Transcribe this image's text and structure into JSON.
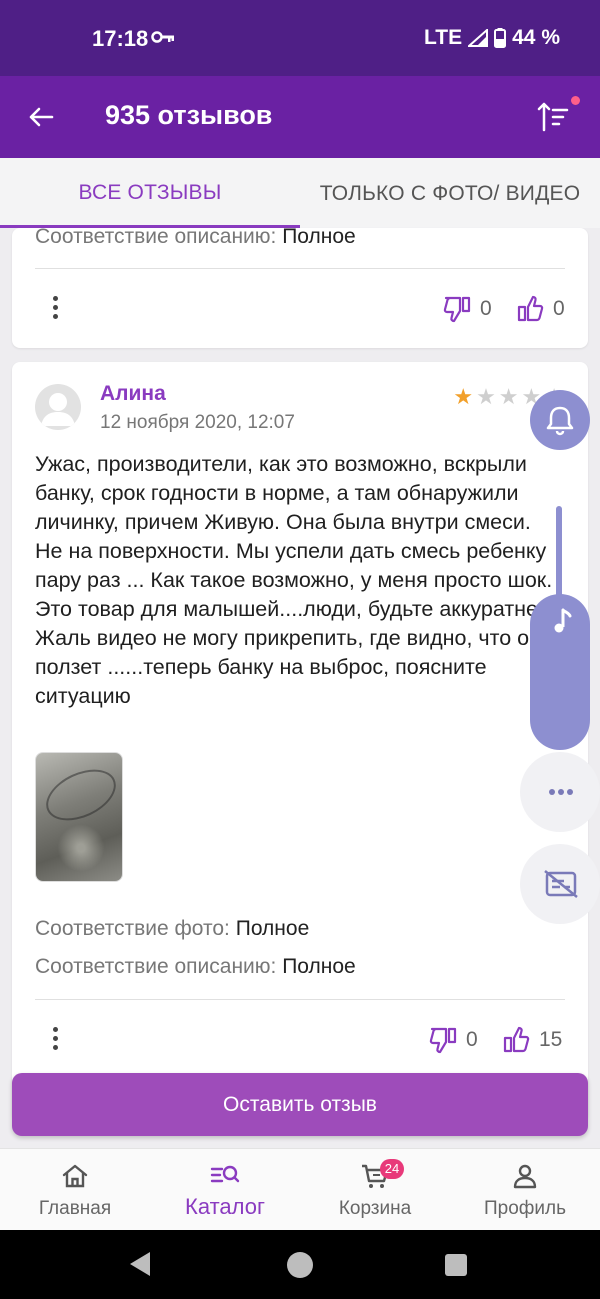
{
  "status_bar": {
    "time": "17:18",
    "network": "LTE",
    "battery": "44 %"
  },
  "app_bar": {
    "title": "935 отзывов"
  },
  "tabs": [
    {
      "label": "Все отзывы"
    },
    {
      "label": "Только с фото/ видео"
    }
  ],
  "review_prev": {
    "match_description_label": "Соответствие описанию:",
    "match_description_value": "Полное",
    "dislikes": "0",
    "likes": "0"
  },
  "review": {
    "author": "Алина",
    "date": "12 ноября 2020, 12:07",
    "rating": 1,
    "rating_max": 5,
    "text": "Ужас, производители, как это возможно, вскрыли банку, срок годности в норме, а там обнаружили личинку, причем Живую. Она была внутри смеси. Не на поверхности. Мы успели дать смесь ребенку пару раз ... Как такое возможно, у меня просто шок. Это товар для малышей....люди, будьте аккуратнее. Жаль видео не могу прикрепить, где видно, что она ползет ......теперь банку на выброс, поясните ситуацию",
    "match_photo_label": "Соответствие фото:",
    "match_photo_value": "Полное",
    "match_description_label": "Соответствие описанию:",
    "match_description_value": "Полное",
    "dislikes": "0",
    "likes": "15"
  },
  "submit_button": "Оставить отзыв",
  "bottom_nav": [
    {
      "label": "Главная",
      "icon": "home-icon"
    },
    {
      "label": "Каталог",
      "icon": "catalog-search-icon"
    },
    {
      "label": "Корзина",
      "icon": "cart-icon",
      "badge": "24"
    },
    {
      "label": "Профиль",
      "icon": "person-icon"
    }
  ],
  "colors": {
    "accent": "#8a3bc0",
    "app_bar": "#6a21a3",
    "status_bar": "#4f1f86",
    "star": "#f2a02b",
    "badge": "#e8397a",
    "floating_panel": "#8d8fd0"
  }
}
